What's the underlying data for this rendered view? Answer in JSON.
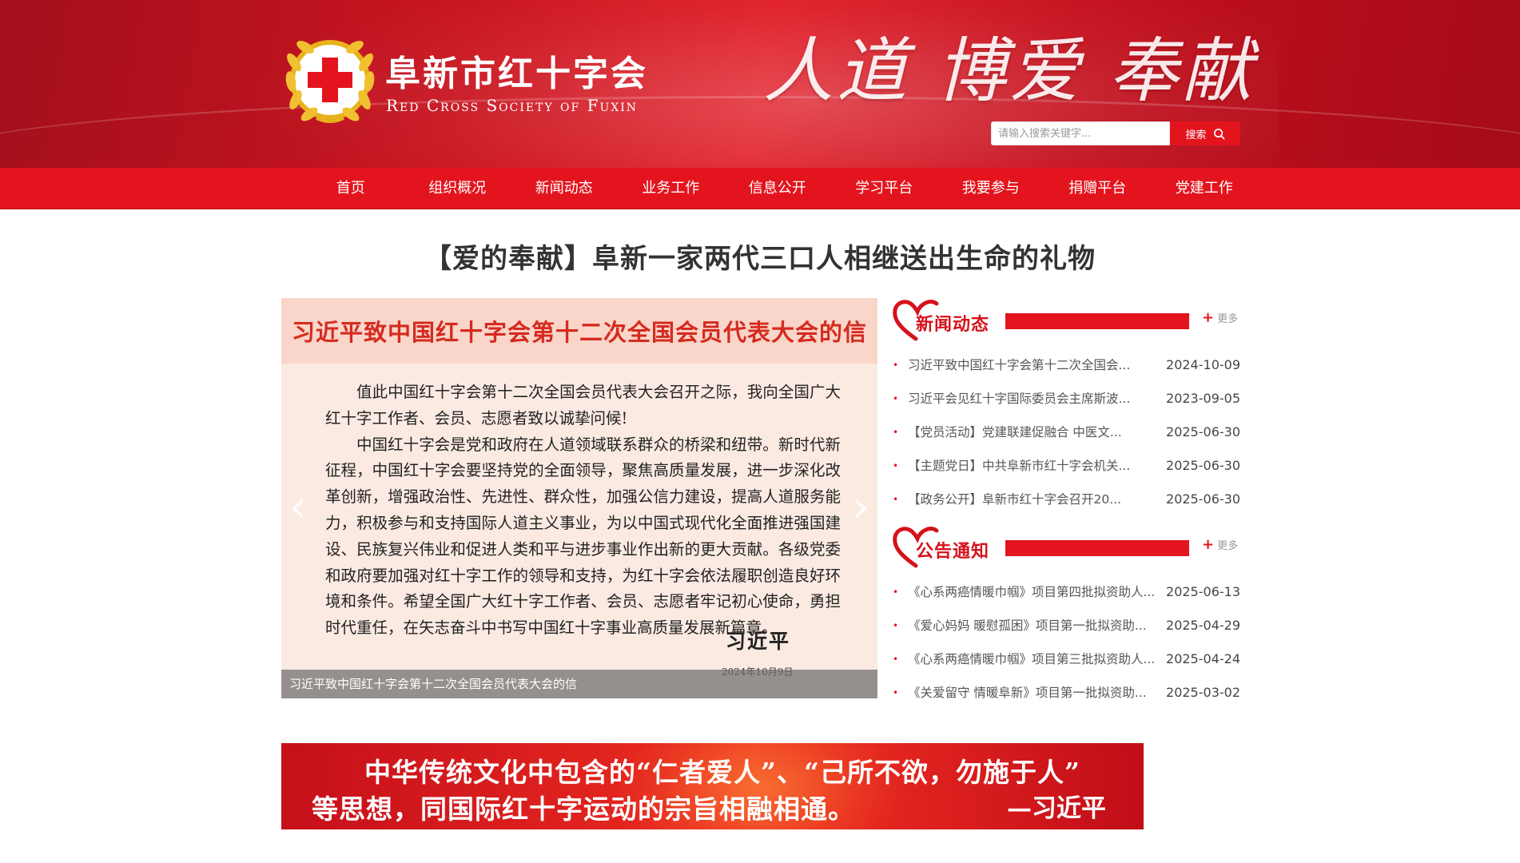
{
  "header": {
    "org_name_cn": "阜新市红十字会",
    "org_name_en": "Red Cross Society of Fuxin",
    "slogan": "人道 博爱 奉献",
    "search": {
      "placeholder": "请输入搜索关键字...",
      "value": "",
      "button_label": "搜索"
    }
  },
  "nav": {
    "items": [
      "首页",
      "组织概况",
      "新闻动态",
      "业务工作",
      "信息公开",
      "学习平台",
      "我要参与",
      "捐赠平台",
      "党建工作"
    ]
  },
  "headline": "【爱的奉献】阜新一家两代三口人相继送出生命的礼物",
  "slider": {
    "letter_title": "习近平致中国红十字会第十二次全国会员代表大会的信",
    "paragraph_1": "值此中国红十字会第十二次全国会员代表大会召开之际，我向全国广大红十字工作者、会员、志愿者致以诚挚问候!",
    "paragraph_2": "中国红十字会是党和政府在人道领域联系群众的桥梁和纽带。新时代新征程，中国红十字会要坚持党的全面领导，聚焦高质量发展，进一步深化改革创新，增强政治性、先进性、群众性，加强公信力建设，提高人道服务能力，积极参与和支持国际人道主义事业，为以中国式现代化全面推进强国建设、民族复兴伟业和促进人类和平与进步事业作出新的更大贡献。各级党委和政府要加强对红十字工作的领导和支持，为红十字会依法履职创造良好环境和条件。希望全国广大红十字工作者、会员、志愿者牢记初心使命，勇担时代重任，在矢志奋斗中书写中国红十字事业高质量发展新篇章。",
    "signature": "习近平",
    "signature_date": "2024年10月9日",
    "caption": "习近平致中国红十字会第十二次全国会员代表大会的信",
    "prev_glyph": "‹",
    "next_glyph": "›"
  },
  "news": {
    "title": "新闻动态",
    "more_label": "更多",
    "items": [
      {
        "title": "习近平致中国红十字会第十二次全国会...",
        "date": "2024-10-09"
      },
      {
        "title": "习近平会见红十字国际委员会主席斯波...",
        "date": "2023-09-05"
      },
      {
        "title": "【党员活动】党建联建促融合 中医文...",
        "date": "2025-06-30"
      },
      {
        "title": "【主题党日】中共阜新市红十字会机关...",
        "date": "2025-06-30"
      },
      {
        "title": "【政务公开】阜新市红十字会召开20...",
        "date": "2025-06-30"
      }
    ]
  },
  "notice": {
    "title": "公告通知",
    "more_label": "更多",
    "items": [
      {
        "title": "《心系两癌情暖巾帼》项目第四批拟资助人...",
        "date": "2025-06-13"
      },
      {
        "title": "《爱心妈妈 暖慰孤困》项目第一批拟资助...",
        "date": "2025-04-29"
      },
      {
        "title": "《心系两癌情暖巾帼》项目第三批拟资助人...",
        "date": "2025-04-24"
      },
      {
        "title": "《关爱留守 情暖阜新》项目第一批拟资助...",
        "date": "2025-03-02"
      }
    ]
  },
  "banner": {
    "line_1": "中华传统文化中包含的“仁者爱人”、“己所不欲，勿施于人”",
    "line_2": "等思想，同国际红十字运动的宗旨相融相通。",
    "author": "—习近平"
  },
  "colors": {
    "brand_red": "#e3141e",
    "header_red": "#c8141f",
    "title_red": "#d5121c",
    "gold": "#e8b21a"
  },
  "icons": {
    "search": "search-icon",
    "logo": "red-cross-emblem-icon",
    "heart": "heart-icon",
    "plus": "plus-icon"
  }
}
